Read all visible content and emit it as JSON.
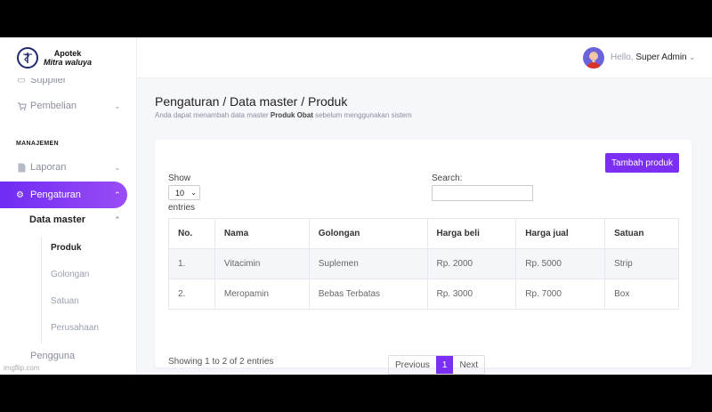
{
  "brand": {
    "line1": "Apotek",
    "line2": "Mitra waluya"
  },
  "sidebar": {
    "items": [
      {
        "label": "Supplier",
        "icon": "truck-icon"
      },
      {
        "label": "Pembelian",
        "icon": "cart-icon"
      }
    ],
    "section_title": "MANAJEMEN",
    "laporan": {
      "label": "Laporan",
      "icon": "file-icon"
    },
    "pengaturan": {
      "label": "Pengaturan",
      "icon": "gears-icon"
    },
    "data_master": "Data master",
    "sub_items": [
      "Produk",
      "Golongan",
      "Satuan",
      "Perusahaan"
    ],
    "pengguna": "Pengguna"
  },
  "topbar": {
    "hello": "Hello,",
    "user": "Super Admin"
  },
  "page": {
    "title": "Pengaturan / Data master / Produk",
    "subtitle_pre": "Anda dapat menambah data master ",
    "subtitle_bold": "Produk Obat",
    "subtitle_post": " sebelum menggunakan sistem"
  },
  "card": {
    "add_button": "Tambah produk",
    "show_label": "Show",
    "show_value": "10",
    "entries_label": "entries",
    "search_label": "Search:",
    "columns": [
      "No.",
      "Nama",
      "Golongan",
      "Harga beli",
      "Harga jual",
      "Satuan"
    ],
    "rows": [
      [
        "1.",
        "Vitacimin",
        "Suplemen",
        "Rp. 2000",
        "Rp. 5000",
        "Strip"
      ],
      [
        "2.",
        "Meropamin",
        "Bebas Terbatas",
        "Rp. 3000",
        "Rp. 7000",
        "Box"
      ]
    ],
    "info": "Showing 1 to 2 of 2 entries",
    "pager": {
      "prev": "Previous",
      "page": "1",
      "next": "Next"
    }
  },
  "watermark": "imgflip.com",
  "colors": {
    "accent": "#7b2ff2"
  }
}
